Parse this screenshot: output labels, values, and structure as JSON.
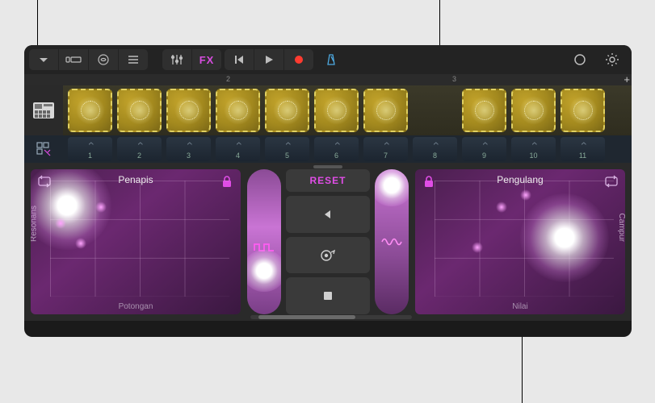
{
  "toolbar": {
    "fx_label": "FX"
  },
  "ruler": {
    "marks": [
      "2",
      "3"
    ]
  },
  "steps": [
    "1",
    "2",
    "3",
    "4",
    "5",
    "6",
    "7",
    "8",
    "9",
    "10",
    "11"
  ],
  "fx": {
    "reset_label": "RESET",
    "left": {
      "title": "Penapis",
      "ylabel": "Resonans",
      "xlabel": "Potongan"
    },
    "right": {
      "title": "Pengulang",
      "ylabel": "Campur",
      "xlabel": "Nilai"
    }
  },
  "colors": {
    "accent": "#e04de6",
    "cell": "#a3891e"
  }
}
